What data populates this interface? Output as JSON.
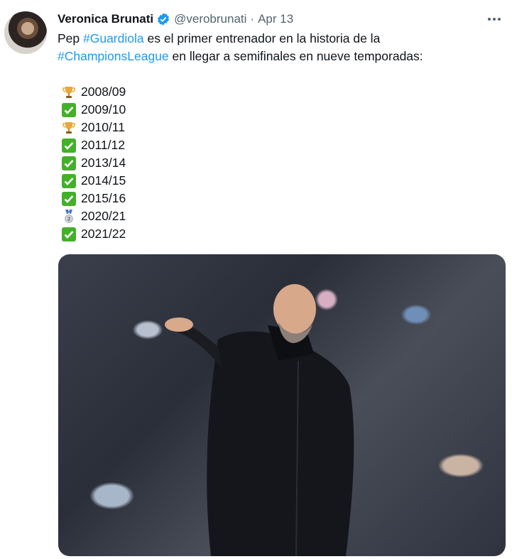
{
  "author": {
    "name": "Veronica Brunati",
    "handle": "@verobrunati",
    "separator": "·",
    "date": "Apr 13"
  },
  "tweet": {
    "text_part1": "Pep ",
    "hashtag1": "#Guardiola",
    "text_part2": " es el primer entrenador en la historia de la",
    "hashtag2": "#ChampionsLeague",
    "text_part3": " en llegar a semifinales en nueve temporadas:"
  },
  "seasons": [
    {
      "icon": "trophy-icon",
      "label": "2008/09"
    },
    {
      "icon": "check-icon",
      "label": "2009/10"
    },
    {
      "icon": "trophy-icon",
      "label": "2010/11"
    },
    {
      "icon": "check-icon",
      "label": "2011/12"
    },
    {
      "icon": "check-icon",
      "label": "2013/14"
    },
    {
      "icon": "check-icon",
      "label": "2014/15"
    },
    {
      "icon": "check-icon",
      "label": "2015/16"
    },
    {
      "icon": "silver-medal-icon",
      "label": "2020/21"
    },
    {
      "icon": "check-icon",
      "label": "2021/22"
    }
  ],
  "colors": {
    "link": "#1d9bf0",
    "muted": "#536471",
    "text": "#0f1419",
    "check_bg": "#43b02a",
    "trophy": "#e9a93a"
  }
}
